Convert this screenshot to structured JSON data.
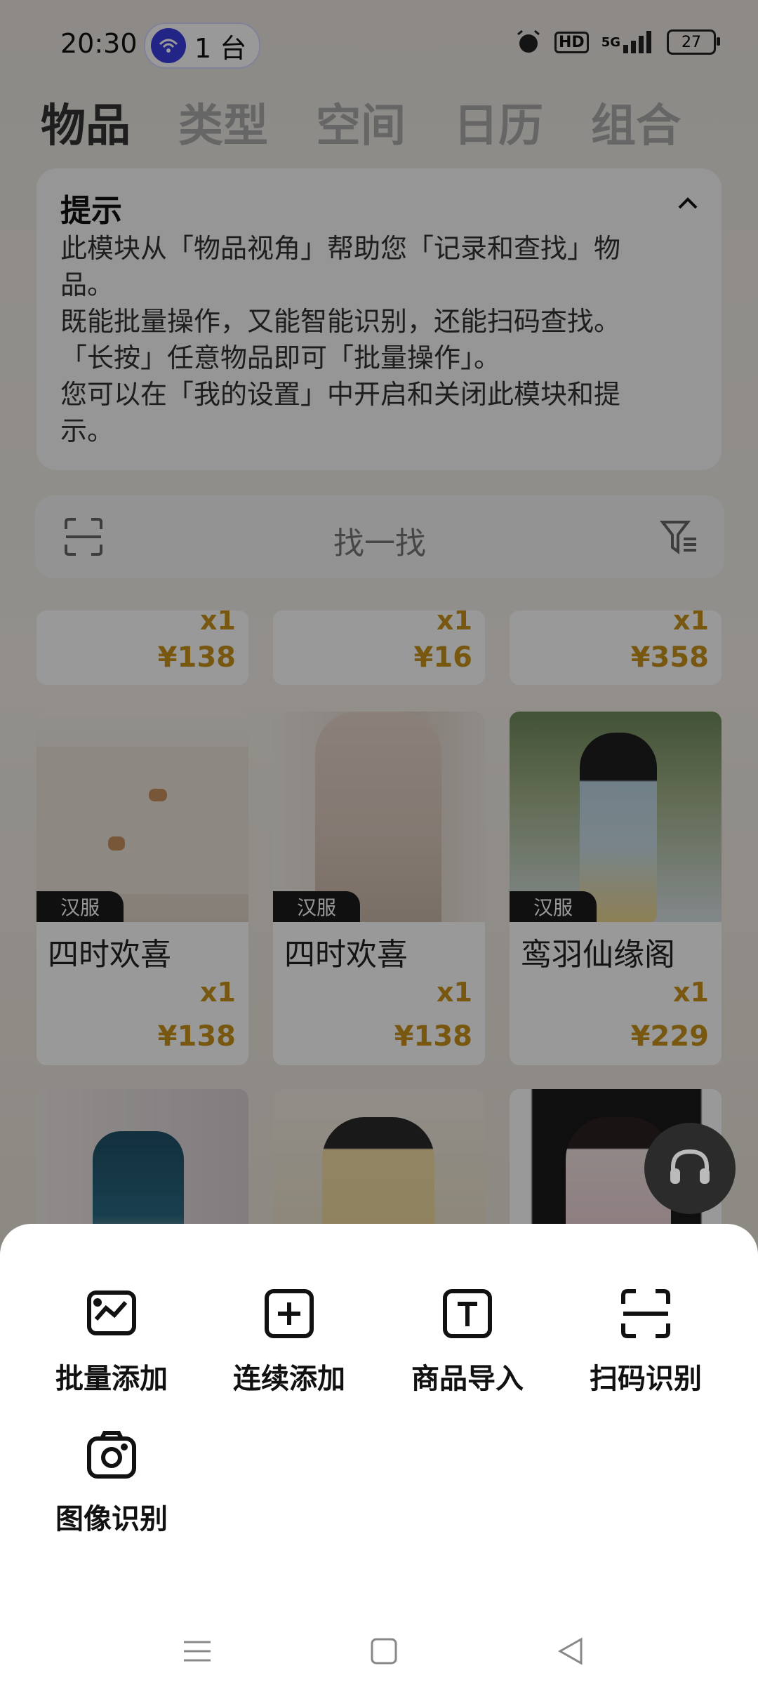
{
  "status_bar": {
    "time": "20:30",
    "connect_count": "1 台",
    "icons": [
      "alarm-icon",
      "hd-icon",
      "5g-signal-icon",
      "battery-icon"
    ],
    "hd": "HD",
    "net": "5G",
    "battery": "27"
  },
  "tabs": [
    {
      "label": "物品",
      "active": true
    },
    {
      "label": "类型"
    },
    {
      "label": "空间"
    },
    {
      "label": "日历"
    },
    {
      "label": "组合"
    }
  ],
  "tip": {
    "title": "提示",
    "lines": [
      "此模块从「物品视角」帮助您「记录和查找」物",
      "品。",
      "既能批量操作，又能智能识别，还能扫码查找。",
      "「长按」任意物品即可「批量操作」。",
      "您可以在「我的设置」中开启和关闭此模块和提",
      "示。"
    ]
  },
  "search": {
    "placeholder": "找一找"
  },
  "items_row_top": [
    {
      "qty": "x1",
      "price": "¥138"
    },
    {
      "qty": "x1",
      "price": "¥16"
    },
    {
      "qty": "x1",
      "price": "¥358"
    }
  ],
  "items_row_mid": [
    {
      "tag": "汉服",
      "name": "四时欢喜",
      "qty": "x1",
      "price": "¥138"
    },
    {
      "tag": "汉服",
      "name": "四时欢喜",
      "qty": "x1",
      "price": "¥138"
    },
    {
      "tag": "汉服",
      "name": "鸾羽仙缘阁",
      "qty": "x1",
      "price": "¥229"
    }
  ],
  "sheet_actions": [
    {
      "label": "批量添加",
      "icon": "image-chart-icon"
    },
    {
      "label": "连续添加",
      "icon": "plus-box-icon"
    },
    {
      "label": "商品导入",
      "icon": "text-box-icon"
    },
    {
      "label": "扫码识别",
      "icon": "scan-icon"
    },
    {
      "label": "图像识别",
      "icon": "camera-icon"
    }
  ],
  "colors": {
    "price": "#c8931d",
    "accent": "#3b3ee0"
  }
}
